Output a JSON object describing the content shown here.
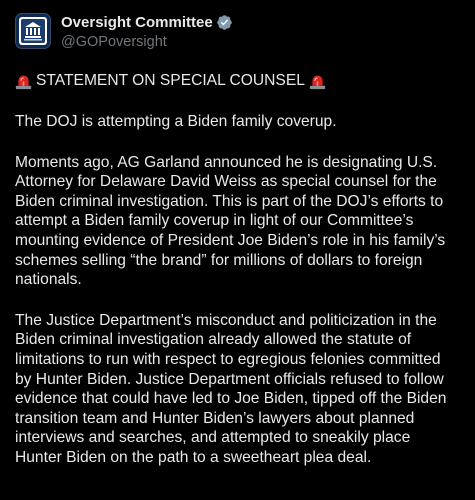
{
  "account": {
    "display_name": "Oversight Committee",
    "handle": "@GOPoversight",
    "avatar_icon": "committee-seal-icon",
    "verified_icon": "verified-badge-icon",
    "verified_color": "#829aab"
  },
  "tweet": {
    "heading_text": "STATEMENT ON SPECIAL COUNSEL",
    "heading_icon": "siren-emoji-icon",
    "siren_color": "#e0231f",
    "paragraph_1": "The DOJ is attempting a Biden family coverup.",
    "paragraph_2": "Moments ago, AG Garland announced he is designating U.S. Attorney for Delaware David Weiss as special counsel for the Biden criminal investigation. This is part of the DOJ’s efforts to attempt a Biden family coverup in light of our Committee’s mounting evidence of President Joe Biden’s role in his family’s schemes selling “the brand” for millions of dollars to foreign nationals.",
    "paragraph_3": "The Justice Department’s misconduct and politicization in the Biden criminal investigation already allowed the statute of limitations to run with respect to egregious felonies committed by Hunter Biden. Justice Department officials refused to follow evidence that could have led to Joe Biden, tipped off the Biden transition team and Hunter Biden’s lawyers about planned interviews and searches, and attempted to sneakily place Hunter Biden on the path to a sweetheart plea deal."
  }
}
